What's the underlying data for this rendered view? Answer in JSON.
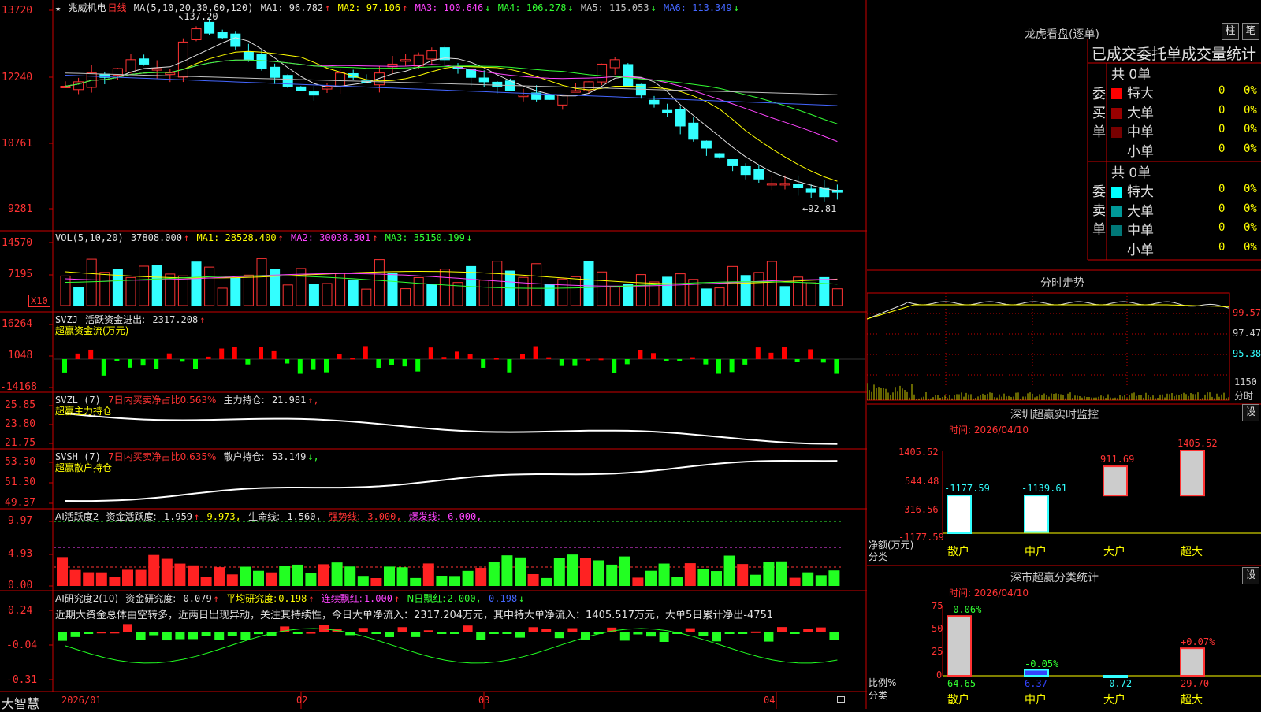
{
  "colors": {
    "up": "#ff3333",
    "down": "#33ffff",
    "grid": "#cc0000",
    "bg": "#000000"
  },
  "main": {
    "star": "★",
    "stock_name": "兆威机电",
    "period": "日线",
    "ma_label": "MA(5,10,20,30,60,120)",
    "ma": [
      {
        "name": "MA1:",
        "value": "96.782",
        "arrow": "↑",
        "color": "#e0e0e0"
      },
      {
        "name": "MA2:",
        "value": "97.106",
        "arrow": "↑",
        "color": "#ffff00"
      },
      {
        "name": "MA3:",
        "value": "100.646",
        "arrow": "↓",
        "color": "#ff44ff"
      },
      {
        "name": "MA4:",
        "value": "106.278",
        "arrow": "↓",
        "color": "#33ff33"
      },
      {
        "name": "MA5:",
        "value": "115.053",
        "arrow": "↓",
        "color": "#c0c0c0"
      },
      {
        "name": "MA6:",
        "value": "113.349",
        "arrow": "↓",
        "color": "#4466ff"
      }
    ],
    "y_ticks": [
      "13720",
      "12240",
      "10761",
      "9281"
    ],
    "high_label": "137.20",
    "low_label": "92.81"
  },
  "vol": {
    "label": "VOL(5,10,20)",
    "value": "37808.000",
    "arrow": "↑",
    "ma": [
      {
        "name": "MA1:",
        "value": "28528.400",
        "arrow": "↑",
        "color": "#ffff00"
      },
      {
        "name": "MA2:",
        "value": "30038.301",
        "arrow": "↑",
        "color": "#ff44ff"
      },
      {
        "name": "MA3:",
        "value": "35150.199",
        "arrow": "↓",
        "color": "#33ff33"
      }
    ],
    "y_ticks": [
      "14570",
      "7195"
    ],
    "x10": "X10"
  },
  "svzj": {
    "label": "SVZJ",
    "name": "活跃资金进出:",
    "value": "2317.208",
    "arrow": "↑",
    "sub": "超赢资金流(万元)",
    "y_ticks": [
      "16264",
      "1048",
      "-14168"
    ]
  },
  "svzl": {
    "label": "SVZL (7)",
    "text1": "7日内买卖净占比0.563%",
    "name": "主力持仓:",
    "value": "21.981",
    "arrow": "↑,",
    "sub": "超赢主力持仓",
    "y_ticks": [
      "25.85",
      "23.80",
      "21.75"
    ]
  },
  "svsh": {
    "label": "SVSH (7)",
    "text1": "7日内买卖净占比0.635%",
    "name": "散户持仓:",
    "value": "53.149",
    "arrow": "↓,",
    "sub": "超赢散户持仓",
    "y_ticks": [
      "53.30",
      "51.30",
      "49.37"
    ]
  },
  "ai1": {
    "label": "AI活跃度2",
    "name": "资金活跃度:",
    "value": "1.959",
    "arrow": "↑",
    "v2": "9.973,",
    "n3": "生命线:",
    "v3": "1.560,",
    "n4": "强势线:",
    "v4": "3.000,",
    "n5": "爆发线:",
    "v5": "6.000,",
    "y_ticks": [
      "9.97",
      "4.93",
      "0.00"
    ]
  },
  "ai2": {
    "label": "AI研究度2(10)",
    "name": "资金研究度:",
    "value": "0.079",
    "arrow": "↑",
    "n2": "平均研究度:",
    "v2": "0.198",
    "a2": "↑",
    "n3": "连续飘红:",
    "v3": "1.000",
    "a3": "↑",
    "n4": "N日飘红:",
    "v4": "2.000,",
    "v5": "0.198",
    "a5": "↓",
    "comment": "近期大资金总体由空转多，近两日出现异动，关注其持续性，今日大单净流入：2317.204万元，其中特大单净流入：1405.517万元，大单5日累计净出-4751",
    "y_ticks": [
      "0.24",
      "-0.04",
      "-0.31"
    ]
  },
  "xaxis": {
    "brand": "大智慧",
    "dates": [
      "2026/01",
      "02",
      "03",
      "04"
    ]
  },
  "longhu": {
    "title": "龙虎看盘(逐单)",
    "btn1": "柱",
    "btn2": "笔",
    "subtitle": "已成交委托单成交量统计",
    "buy": {
      "side": "委买单",
      "total": "共 0单",
      "rows": [
        {
          "name": "特大",
          "v": "0",
          "p": "0%",
          "c": "#ff0000"
        },
        {
          "name": "大单",
          "v": "0",
          "p": "0%",
          "c": "#990000"
        },
        {
          "name": "中单",
          "v": "0",
          "p": "0%",
          "c": "#770000"
        },
        {
          "name": "小单",
          "v": "0",
          "p": "0%",
          "c": ""
        }
      ]
    },
    "sell": {
      "side": "委卖单",
      "total": "共 0单",
      "rows": [
        {
          "name": "特大",
          "v": "0",
          "p": "0%",
          "c": "#00ffff"
        },
        {
          "name": "大单",
          "v": "0",
          "p": "0%",
          "c": "#009999"
        },
        {
          "name": "中单",
          "v": "0",
          "p": "0%",
          "c": "#007777"
        },
        {
          "name": "小单",
          "v": "0",
          "p": "0%",
          "c": ""
        }
      ]
    }
  },
  "fenshi": {
    "title": "分时走势",
    "y_ticks": [
      "99.57",
      "97.47",
      "95.38"
    ],
    "vol_tick": "1150",
    "vol_label": "分时"
  },
  "sz_monitor": {
    "title": "深圳超赢实时监控",
    "btn": "设",
    "time": "时间: 2026/04/10",
    "y_ticks": [
      "1405.52",
      "544.48",
      "-316.56",
      "-1177.59"
    ],
    "ylabel1": "净额(万元)",
    "ylabel2": "分类",
    "bars": [
      {
        "cat": "散户",
        "value": -1177.59,
        "label": "-1177.59"
      },
      {
        "cat": "中户",
        "value": -1139.61,
        "label": "-1139.61"
      },
      {
        "cat": "大户",
        "value": 911.69,
        "label": "911.69"
      },
      {
        "cat": "超大",
        "value": 1405.52,
        "label": "1405.52"
      }
    ]
  },
  "sz_class": {
    "title": "深市超赢分类统计",
    "btn": "设",
    "time": "时间: 2026/04/10",
    "y_ticks": [
      "75",
      "50",
      "25",
      "0"
    ],
    "ylabel1": "比例%",
    "ylabel2": "分类",
    "bars": [
      {
        "cat": "散户",
        "value": 64.65,
        "label": "64.65",
        "delta": "-0.06%"
      },
      {
        "cat": "中户",
        "value": 6.37,
        "label": "6.37",
        "delta": "-0.05%"
      },
      {
        "cat": "大户",
        "value": -0.72,
        "label": "-0.72",
        "delta": ""
      },
      {
        "cat": "超大",
        "value": 29.7,
        "label": "29.70",
        "delta": "+0.07%"
      }
    ]
  }
}
